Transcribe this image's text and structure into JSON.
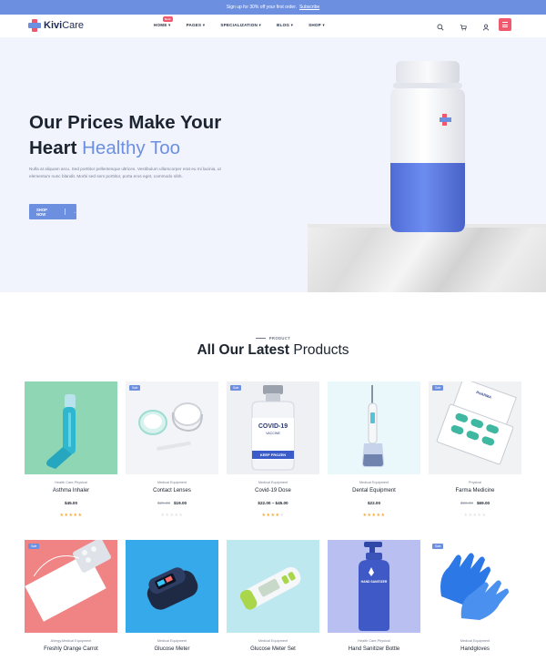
{
  "topbar": {
    "text": "Sign up for 30% off your first order.",
    "link": "Subscribe"
  },
  "brand": {
    "name_bold": "Kivi",
    "name_thin": "Care"
  },
  "menu": [
    {
      "label": "HOME ▾",
      "badge": "New"
    },
    {
      "label": "PAGES ▾"
    },
    {
      "label": "SPECIALIZATION ▾"
    },
    {
      "label": "BLOG ▾"
    },
    {
      "label": "SHOP ▾"
    }
  ],
  "icons": {
    "search": "search-icon",
    "cart": "cart-icon",
    "user": "user-icon",
    "menu": "hamburger-icon"
  },
  "hero": {
    "title_line1": "Our Prices Make Your",
    "title_line2_bold": "Heart",
    "title_line2_accent": "Healthy Too",
    "description": "Nulla at aliquam arcu. Sed porttitor pellentesque ultrices. Vestibulum ullamcorper erat eu mi lacinia, ut elementum nunc blandit. Morbi sed sem porttitor, porta eros eget, commodo nibh.",
    "button": "SHOP NOW",
    "button_arrow": "→"
  },
  "products_section": {
    "label": "PRODUCT",
    "title_bold": "All Our Latest",
    "title_regular": "Products"
  },
  "products": [
    {
      "category": "Health Care,Physical",
      "name": "Asthma Inhaler",
      "price": "$45.00",
      "old_price": "",
      "rating": 5,
      "sale": ""
    },
    {
      "category": "Medical Equipment",
      "name": "Contact Lenses",
      "price": "$19.00",
      "old_price": "$26.00",
      "rating": 0,
      "sale": "Sale"
    },
    {
      "category": "Medical Equipment",
      "name": "Covid-19 Dose",
      "price": "$22.00 – $45.00",
      "old_price": "",
      "rating": 4,
      "sale": "Sale"
    },
    {
      "category": "Medical Equipment",
      "name": "Dental Equipment",
      "price": "$22.00",
      "old_price": "",
      "rating": 5,
      "sale": ""
    },
    {
      "category": "Physical",
      "name": "Farma Medicine",
      "price": "$69.00",
      "old_price": "$69.00",
      "rating": 0,
      "sale": "Sale"
    },
    {
      "category": "Allergy,Medical Equipment",
      "name": "Freshly Orange Carrot",
      "price": "",
      "old_price": "",
      "rating": 0,
      "sale": "Sale"
    },
    {
      "category": "Medical Equipment",
      "name": "Glucose Meter",
      "price": "",
      "old_price": "",
      "rating": 0,
      "sale": ""
    },
    {
      "category": "Medical Equipment",
      "name": "Glucose Meter Set",
      "price": "",
      "old_price": "",
      "rating": 0,
      "sale": ""
    },
    {
      "category": "Health Care,Physical",
      "name": "Hand Sanitizer Bottle",
      "price": "",
      "old_price": "",
      "rating": 0,
      "sale": ""
    },
    {
      "category": "Medical Equipment",
      "name": "Handgloves",
      "price": "",
      "old_price": "",
      "rating": 0,
      "sale": "Sale"
    }
  ],
  "image_text": {
    "vaccine_line1": "COVID-19",
    "vaccine_line2": "VACCINE",
    "vaccine_label": "KEEP FROZEN",
    "pharma_label": "PHARMA",
    "sanitizer_label": "HAND SANITIZER"
  },
  "colors": {
    "accent": "#6d8fe0",
    "brand_red": "#f0586d",
    "star": "#f4a83b",
    "hero_bg": "#f1f4fd"
  }
}
